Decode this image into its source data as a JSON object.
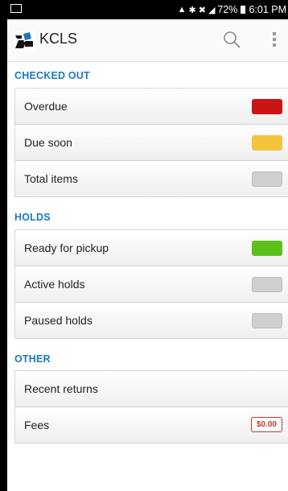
{
  "status_bar": {
    "battery": "72%",
    "time": "6:01 PM",
    "icons": [
      "photo-icon",
      "alarm-icon",
      "bluetooth-icon",
      "mute-icon",
      "signal-icon",
      "battery-icon"
    ]
  },
  "app_bar": {
    "title": "KCLS",
    "icons": [
      "kcls-logo-icon",
      "search-icon",
      "overflow-menu-icon"
    ]
  },
  "sections": {
    "checked_out": {
      "header": "CHECKED OUT",
      "rows": {
        "overdue": {
          "label": "Overdue",
          "indicator_color": "#cc1414"
        },
        "due_soon": {
          "label": "Due soon",
          "indicator_color": "#f2c53d"
        },
        "total_items": {
          "label": "Total items",
          "indicator_color": "#cfcfcf"
        }
      }
    },
    "holds": {
      "header": "HOLDS",
      "rows": {
        "ready_for_pickup": {
          "label": "Ready for pickup",
          "indicator_color": "#5cc21a"
        },
        "active_holds": {
          "label": "Active holds",
          "indicator_color": "#cfcfcf"
        },
        "paused_holds": {
          "label": "Paused holds",
          "indicator_color": "#cfcfcf"
        }
      }
    },
    "other": {
      "header": "OTHER",
      "rows": {
        "recent_returns": {
          "label": "Recent returns"
        },
        "fees": {
          "label": "Fees",
          "amount": "$0.00",
          "badge_color": "#c0392b"
        }
      }
    }
  }
}
